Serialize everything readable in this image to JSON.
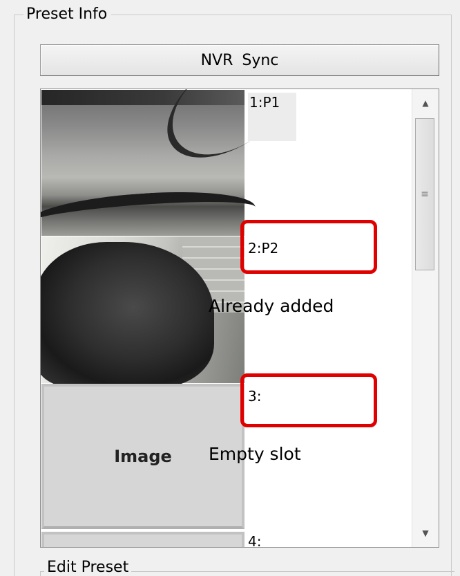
{
  "preset_info": {
    "title": "Preset Info",
    "nvr_sync_label": "NVR  Sync"
  },
  "presets": [
    {
      "label": "1:P1"
    },
    {
      "label": "2:P2"
    },
    {
      "label": "3:",
      "placeholder": "Image"
    },
    {
      "label": "4:"
    }
  ],
  "annotations": {
    "already_added": "Already added",
    "empty_slot": "Empty slot"
  },
  "edit_preset": {
    "title": "Edit Preset"
  },
  "colors": {
    "highlight": "#e00000"
  }
}
